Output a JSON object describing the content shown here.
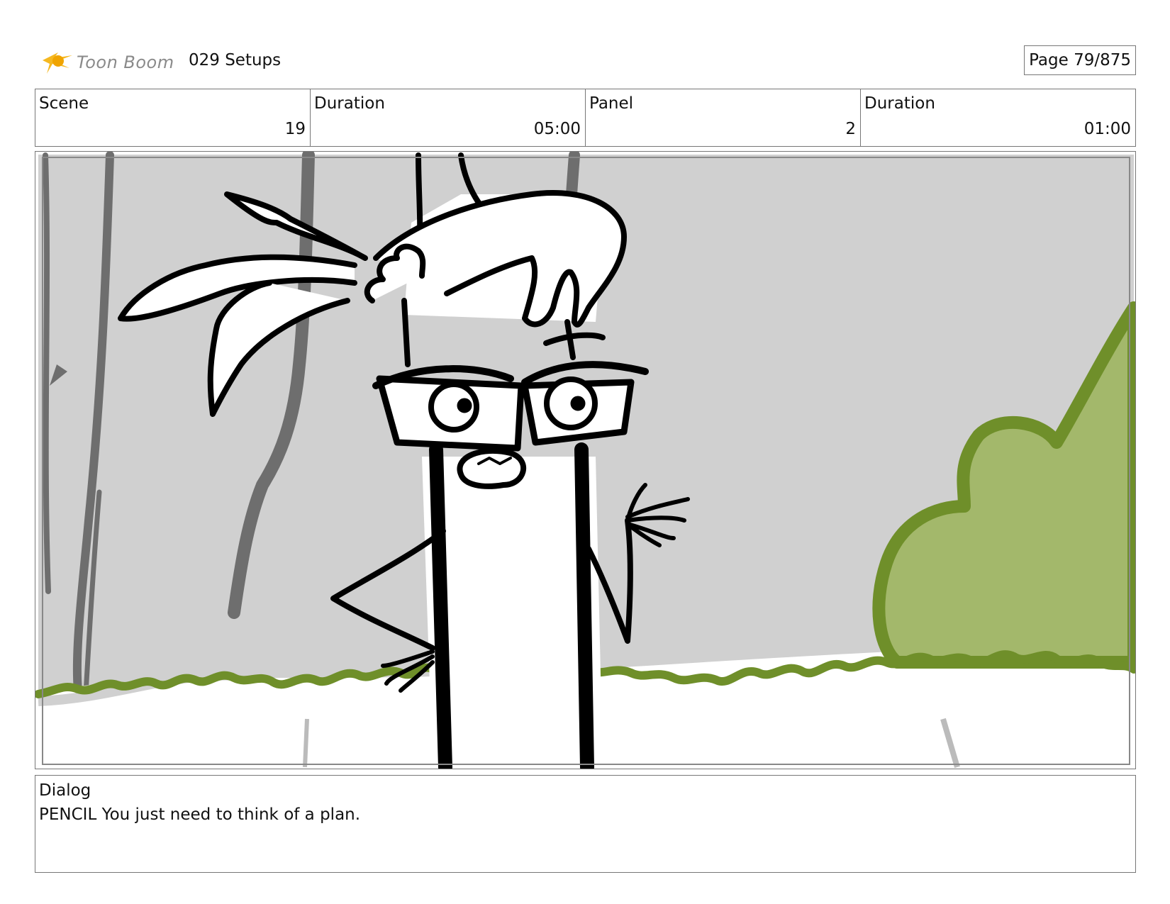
{
  "header": {
    "logo_text": "Toon Boom",
    "title": "029 Setups",
    "page": "Page  79/875"
  },
  "info": [
    {
      "label": "Scene",
      "value": "19"
    },
    {
      "label": "Duration",
      "value": "05:00"
    },
    {
      "label": "Panel",
      "value": "2"
    },
    {
      "label": "Duration",
      "value": "01:00"
    }
  ],
  "panel": {
    "colors": {
      "background": "#d0d0d0",
      "tree_trunks": "#6e6e6e",
      "bush_fill": "#a3b86b",
      "bush_outline": "#6f8f2a",
      "ink": "#000000"
    },
    "icons": [
      "toon-boom-logo",
      "pencil-character",
      "tree-trunk",
      "bush"
    ]
  },
  "dialog": {
    "label": "Dialog",
    "text": "PENCIL You just need to think of a plan."
  }
}
